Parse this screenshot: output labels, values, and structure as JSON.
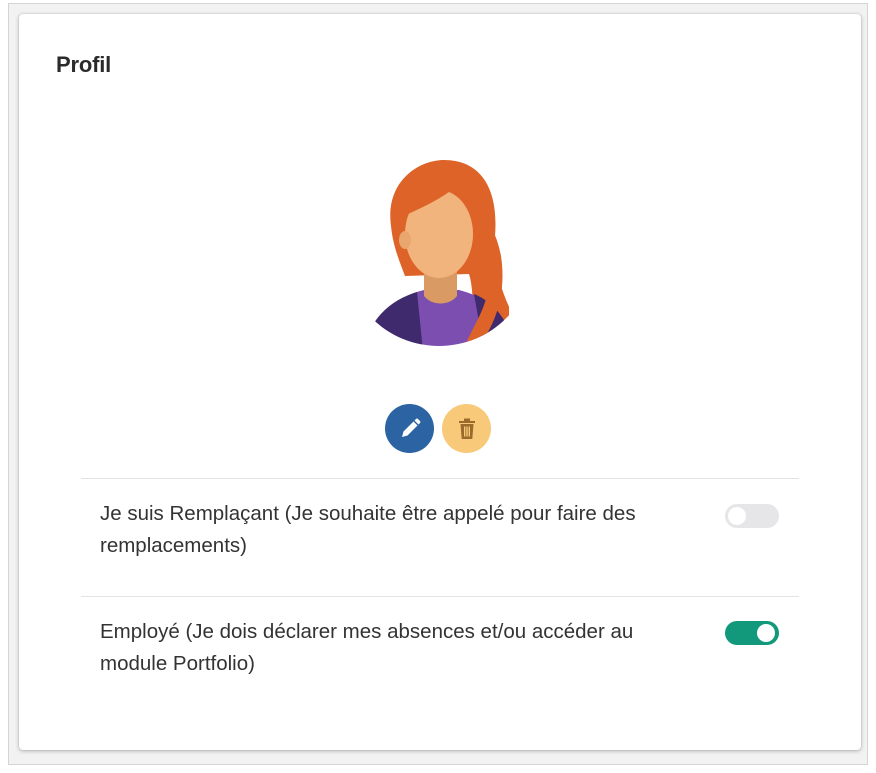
{
  "profile": {
    "title": "Profil"
  },
  "avatar": {
    "icon": "avatar-female-redhead",
    "colors": {
      "hair": "#de6328",
      "skin": "#f2b47d",
      "shirt": "#7b4eb0",
      "shirt_dark": "#3f2a6d"
    }
  },
  "actions": {
    "edit_icon": "pencil-icon",
    "delete_icon": "trash-icon",
    "edit_color": "#2c63a3",
    "delete_color": "#f7c978"
  },
  "options": [
    {
      "label": "Je suis Remplaçant (Je souhaite être appelé pour faire des remplacements)",
      "enabled": false
    },
    {
      "label": "Employé (Je dois déclarer mes absences et/ou accéder au module Portfolio)",
      "enabled": true
    }
  ],
  "colors": {
    "toggle_on": "#12987a",
    "toggle_off": "#e6e6e9",
    "text": "#333333"
  }
}
